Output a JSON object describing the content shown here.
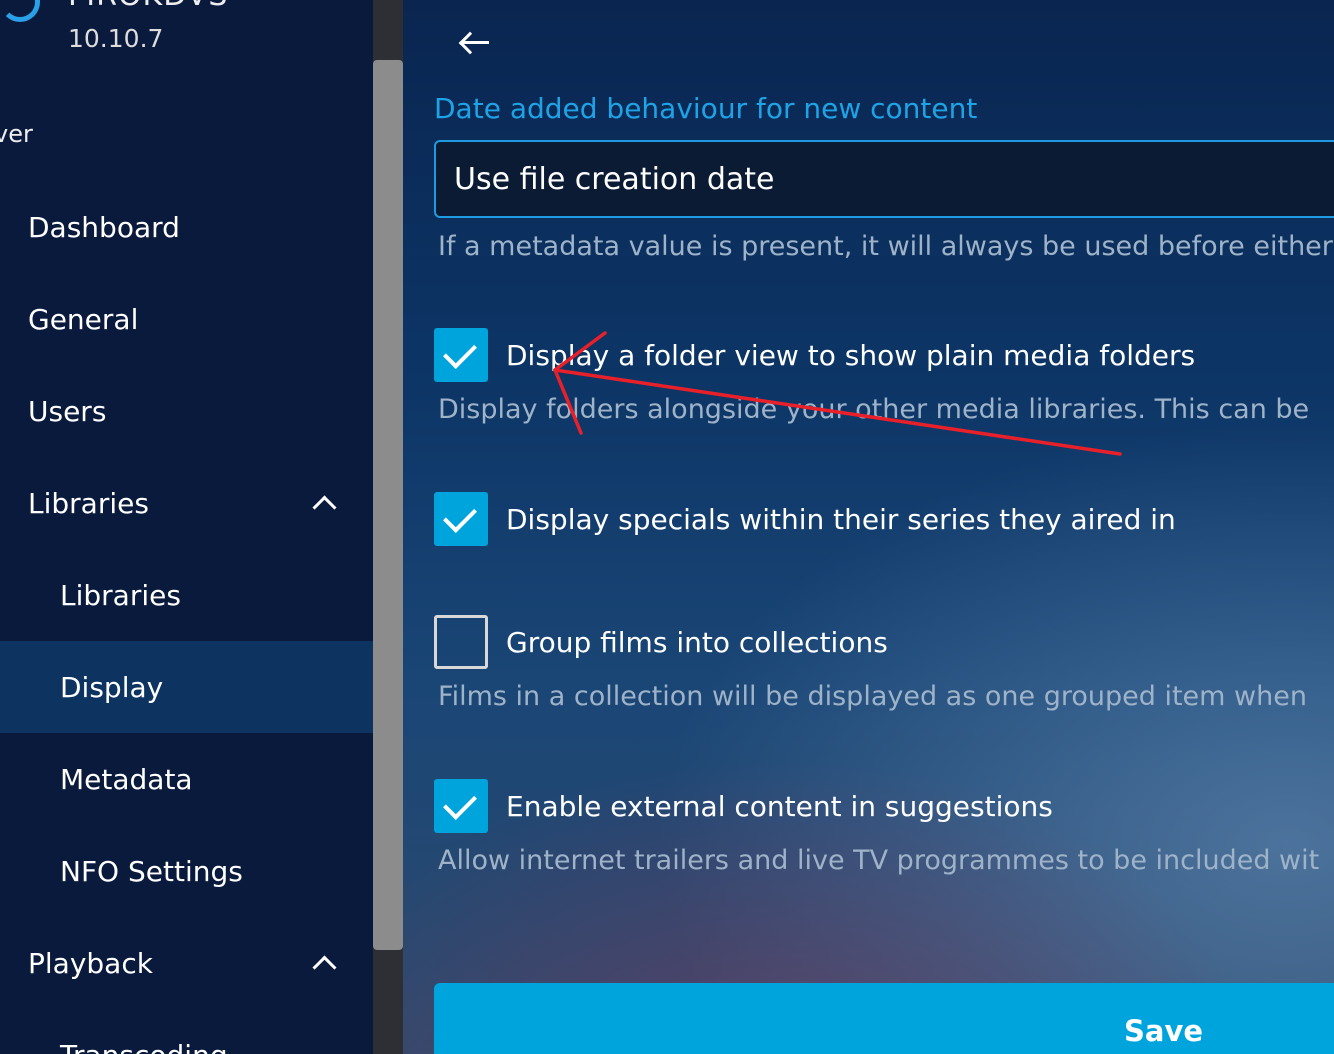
{
  "sidebar": {
    "server_name": "FIROKDVS",
    "version": "10.10.7",
    "section_label": "ver",
    "items": [
      {
        "label": "Dashboard"
      },
      {
        "label": "General"
      },
      {
        "label": "Users"
      },
      {
        "label": "Libraries"
      },
      {
        "label": "Libraries"
      },
      {
        "label": "Display"
      },
      {
        "label": "Metadata"
      },
      {
        "label": "NFO Settings"
      },
      {
        "label": "Playback"
      },
      {
        "label": "Transcoding"
      }
    ]
  },
  "main": {
    "date_added": {
      "label": "Date added behaviour for new content",
      "value": "Use file creation date",
      "help": "If a metadata value is present, it will always be used before either"
    },
    "options": [
      {
        "label": "Display a folder view to show plain media folders",
        "checked": true,
        "help": "Display folders alongside your other media libraries. This can be"
      },
      {
        "label": "Display specials within their series they aired in",
        "checked": true,
        "help": ""
      },
      {
        "label": "Group films into collections",
        "checked": false,
        "help": "Films in a collection will be displayed as one grouped item when"
      },
      {
        "label": "Enable external content in suggestions",
        "checked": true,
        "help": "Allow internet trailers and live TV programmes to be included wit"
      }
    ],
    "save_label": "Save"
  },
  "colors": {
    "accent": "#00a4dc",
    "annotation": "#e8202a"
  }
}
